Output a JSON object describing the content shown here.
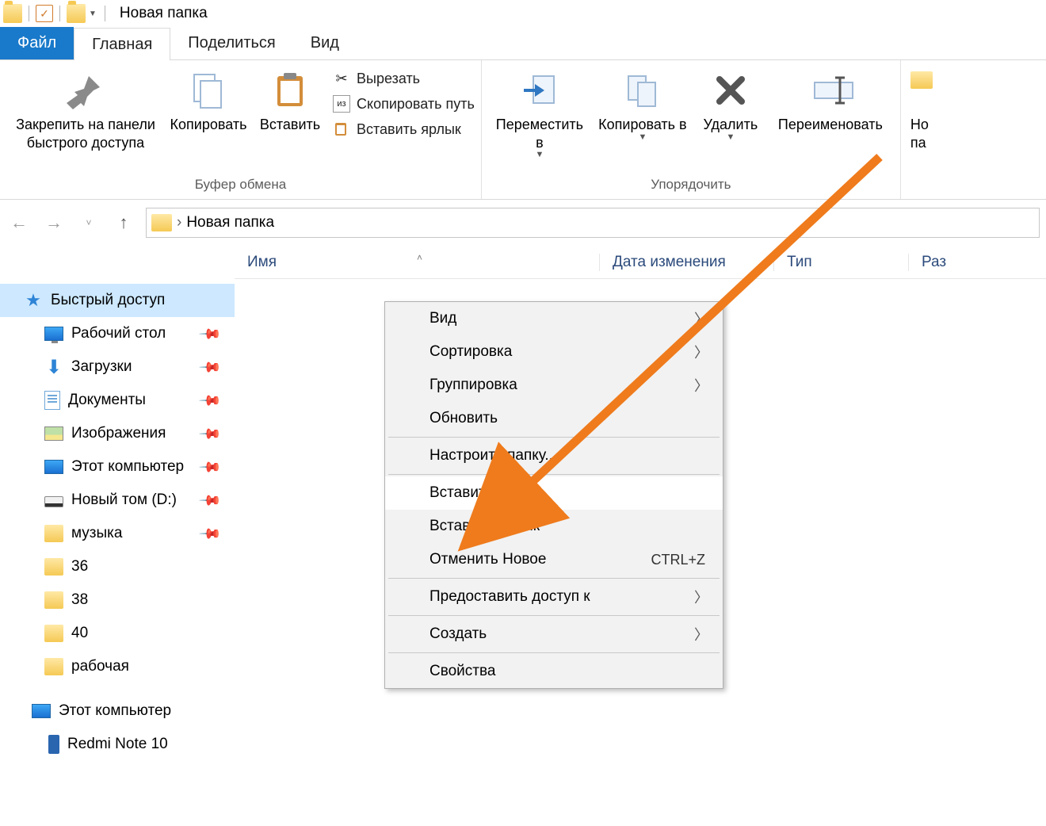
{
  "title": "Новая папка",
  "tabs": {
    "file": "Файл",
    "home": "Главная",
    "share": "Поделиться",
    "view": "Вид"
  },
  "ribbon": {
    "clipboard": {
      "label": "Буфер обмена",
      "pin": "Закрепить на панели быстрого доступа",
      "copy": "Копировать",
      "paste": "Вставить",
      "cut": "Вырезать",
      "copy_path": "Скопировать путь",
      "paste_shortcut": "Вставить ярлык"
    },
    "organize": {
      "label": "Упорядочить",
      "move_to": "Переместить в ",
      "copy_to": "Копировать в ",
      "delete": "Удалить",
      "rename": "Переименовать"
    },
    "new_partial": "Но\nпа"
  },
  "address": {
    "folder": "Новая папка"
  },
  "columns": {
    "name": "Имя",
    "date": "Дата изменения",
    "type": "Тип",
    "size": "Раз"
  },
  "sidebar": {
    "quick_access": "Быстрый доступ",
    "items": [
      {
        "label": "Рабочий стол",
        "icon": "monitor",
        "pin": true
      },
      {
        "label": "Загрузки",
        "icon": "down",
        "pin": true
      },
      {
        "label": "Документы",
        "icon": "doc",
        "pin": true
      },
      {
        "label": "Изображения",
        "icon": "img",
        "pin": true
      },
      {
        "label": "Этот компьютер",
        "icon": "computer",
        "pin": true
      },
      {
        "label": "Новый том (D:)",
        "icon": "disk",
        "pin": true
      },
      {
        "label": "музыка",
        "icon": "folder",
        "pin": true
      },
      {
        "label": "36",
        "icon": "folder",
        "pin": false
      },
      {
        "label": "38",
        "icon": "folder",
        "pin": false
      },
      {
        "label": "40",
        "icon": "folder",
        "pin": false
      },
      {
        "label": "рабочая",
        "icon": "folder",
        "pin": false
      }
    ],
    "this_pc": "Этот компьютер",
    "phone": "Redmi Note 10"
  },
  "context_menu": {
    "view": "Вид",
    "sort": "Сортировка",
    "group": "Группировка",
    "refresh": "Обновить",
    "customize": "Настроить папку...",
    "paste": "Вставить",
    "paste_shortcut": "Вставить ярлык",
    "undo_new": "Отменить Новое",
    "undo_shortcut": "CTRL+Z",
    "give_access": "Предоставить доступ к",
    "create": "Создать",
    "properties": "Свойства"
  }
}
